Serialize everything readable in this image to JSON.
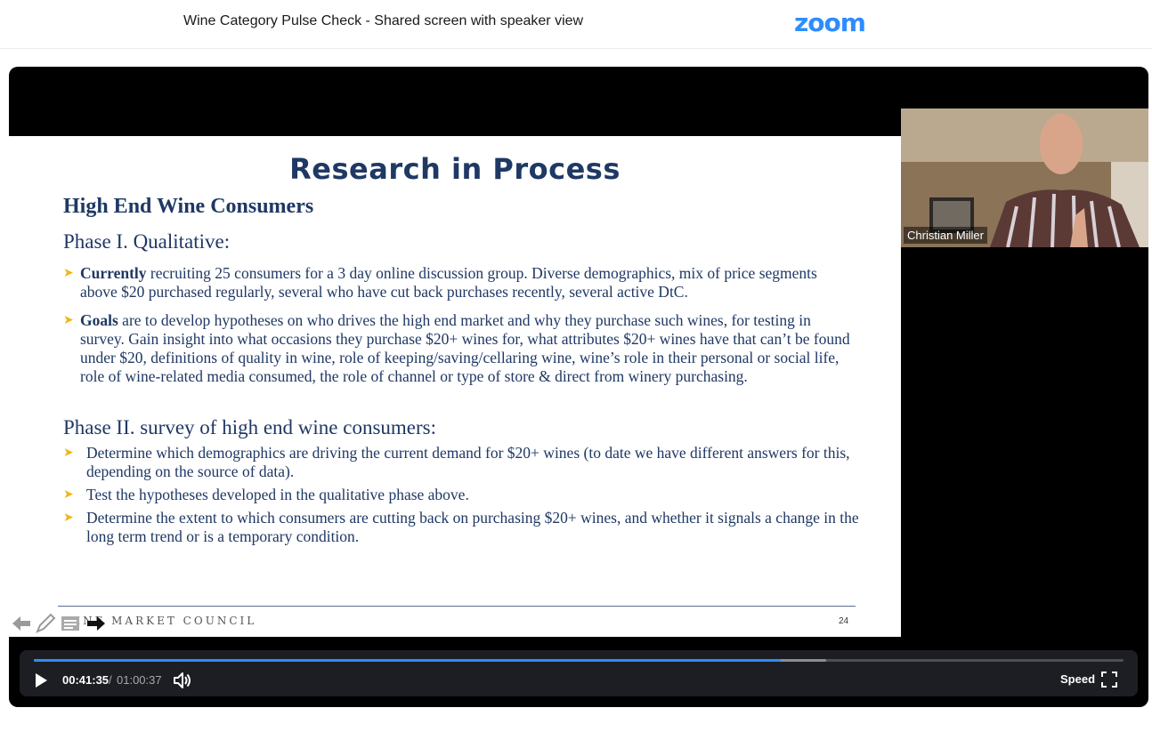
{
  "header": {
    "title": "Wine Category Pulse Check - Shared screen with speaker view",
    "brand": "zoom",
    "brand_color": "#2d8cff"
  },
  "slide": {
    "title": "Research in Process",
    "heading": "High End Wine Consumers",
    "phase1": "Phase I. Qualitative:",
    "phase1_bullets": [
      {
        "lead": "Currently",
        "text": " recruiting 25 consumers for a 3 day online discussion group.  Diverse demographics, mix of price segments above $20 purchased regularly, several who have cut back purchases recently, several active DtC."
      },
      {
        "lead": "Goals",
        "text": " are to develop hypotheses on who drives the high end market and why they purchase such wines,  for testing in survey. Gain insight into what occasions they purchase $20+ wines for, what attributes $20+ wines have that can’t be found under $20, definitions of quality in wine, role of keeping/saving/cellaring wine, wine’s role in their personal or social life, role of wine-related media consumed, the role of channel or type of store & direct from winery purchasing."
      }
    ],
    "phase2": "Phase II. survey of high end wine consumers:",
    "phase2_bullets": [
      "Determine which demographics are driving the current demand for $20+ wines (to date we have different answers for this, depending on the source of data).",
      "Test the hypotheses developed in the qualitative phase above.",
      "Determine the extent to which consumers are cutting back on purchasing $20+ wines, and whether it signals a change in the long term trend or is a temporary condition."
    ],
    "footer_text": "WINE MARKET COUNCIL",
    "page_number": "24",
    "title_color": "#1f3864",
    "bullet_color": "#f2b518"
  },
  "speaker": {
    "name": "Christian Miller"
  },
  "controls": {
    "current_time": "00:41:35",
    "separator": "/",
    "total_time": "01:00:37",
    "played_fraction": 0.6858,
    "buffered_fraction": 0.727,
    "speed_label": "Speed",
    "progress_color": "#2d8cff"
  }
}
